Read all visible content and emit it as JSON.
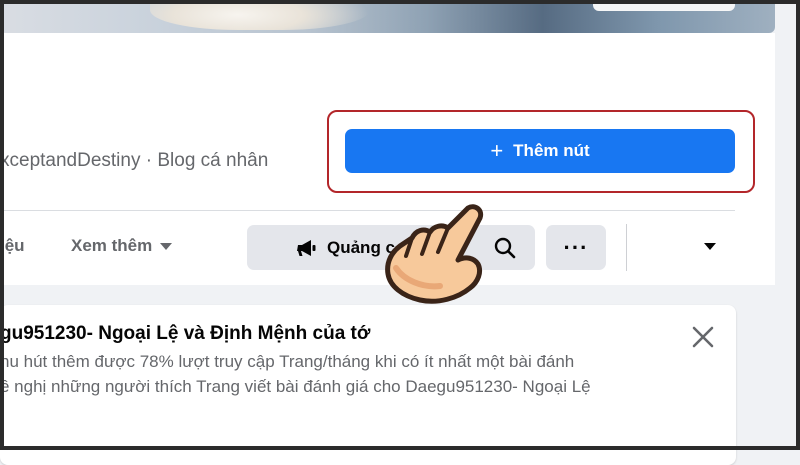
{
  "page": {
    "meta_text": "xceptandDestiny · Blog cá nhân"
  },
  "cta": {
    "label": "Thêm nút",
    "icon": "plus-icon"
  },
  "tabs": {
    "partial_label": "iệu",
    "more_label": "Xem thêm"
  },
  "actions": {
    "promote_label": "Quảng c",
    "promote_icon": "megaphone-icon",
    "search_icon": "search-icon",
    "more_icon": "ellipsis-icon"
  },
  "card": {
    "title": "gu951230- Ngoại Lệ và Định Mệnh của tớ",
    "line1": "hu hút thêm được 78% lượt truy cập Trang/tháng khi có ít nhất một bài đánh",
    "line2": "ề nghị những người thích Trang viết bài đánh giá cho Daegu951230- Ngoại Lệ"
  },
  "colors": {
    "accent": "#1877f2",
    "highlight_outline": "#b3262a"
  }
}
